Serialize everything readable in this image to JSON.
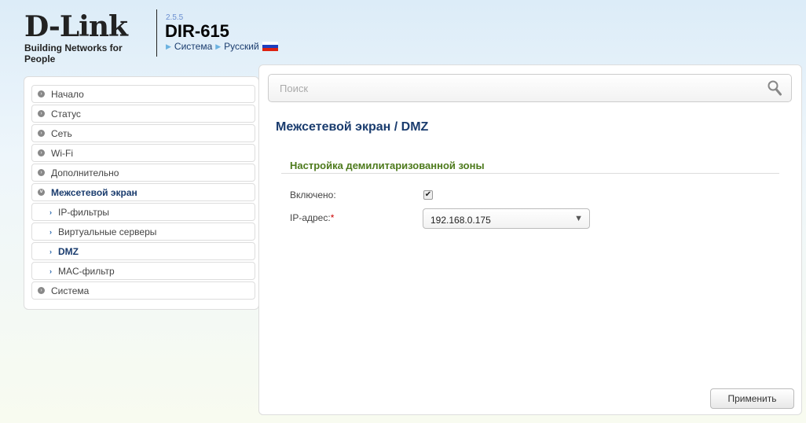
{
  "header": {
    "brand": "D-Link",
    "tagline": "Building Networks for People",
    "version": "2.5.5",
    "model": "DIR-615",
    "crumb_system": "Система",
    "crumb_language": "Русский"
  },
  "sidebar": {
    "items": [
      {
        "label": "Начало"
      },
      {
        "label": "Статус"
      },
      {
        "label": "Сеть"
      },
      {
        "label": "Wi-Fi"
      },
      {
        "label": "Дополнительно"
      },
      {
        "label": "Межсетевой экран"
      },
      {
        "label": "IP-фильтры"
      },
      {
        "label": "Виртуальные серверы"
      },
      {
        "label": "DMZ"
      },
      {
        "label": "MAC-фильтр"
      },
      {
        "label": "Система"
      }
    ]
  },
  "search": {
    "placeholder": "Поиск"
  },
  "main": {
    "title": "Межсетевой экран /  DMZ",
    "section": "Настройка демилитаризованной зоны",
    "enabled_label": "Включено:",
    "enabled": true,
    "ip_label": "IP-адрес:",
    "required_mark": "*",
    "ip_value": "192.168.0.175",
    "apply": "Применить"
  }
}
